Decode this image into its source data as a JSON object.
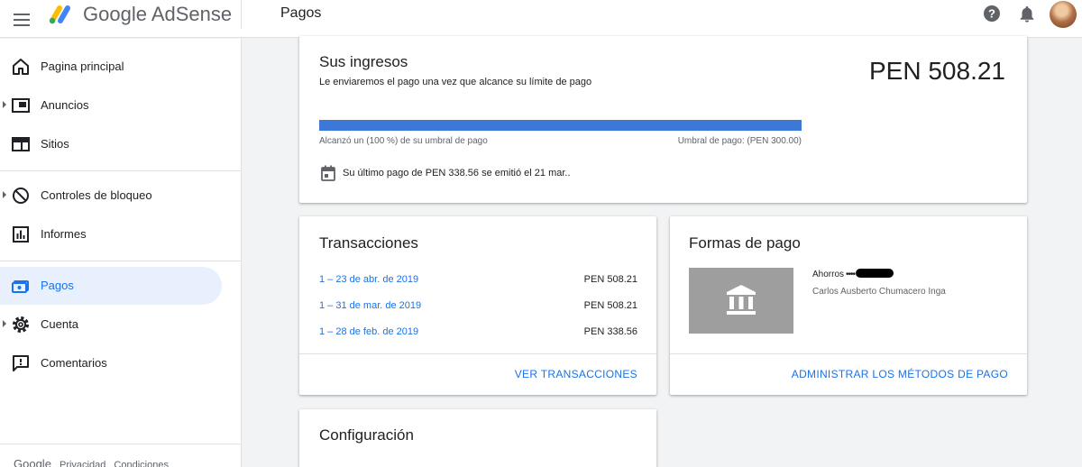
{
  "header": {
    "brand": "Google AdSense",
    "page_title": "Pagos"
  },
  "sidebar": {
    "items": [
      {
        "label": "Pagina principal",
        "icon": "home-icon"
      },
      {
        "label": "Anuncios",
        "icon": "ads-icon"
      },
      {
        "label": "Sitios",
        "icon": "sites-icon"
      },
      {
        "label": "Controles de bloqueo",
        "icon": "block-icon"
      },
      {
        "label": "Informes",
        "icon": "reports-icon"
      },
      {
        "label": "Pagos",
        "icon": "payments-icon",
        "active": true
      },
      {
        "label": "Cuenta",
        "icon": "gear-icon"
      },
      {
        "label": "Comentarios",
        "icon": "feedback-icon"
      }
    ],
    "footer": {
      "google": "Google",
      "privacy": "Privacidad",
      "terms": "Condiciones"
    }
  },
  "earnings": {
    "title": "Sus ingresos",
    "subtitle": "Le enviaremos el pago una vez que alcance su límite de pago",
    "amount": "PEN 508.21",
    "progress_fraction": 1.0,
    "progress_left": "Alcanzó un (100 %) de su umbral de pago",
    "progress_right": "Umbral de pago: (PEN 300.00)",
    "last_payment": "Su último pago de PEN 338.56 se emitió el 21 mar.."
  },
  "transactions": {
    "title": "Transacciones",
    "rows": [
      {
        "period": "1 – 23 de abr. de 2019",
        "amount": "PEN 508.21"
      },
      {
        "period": "1 – 31 de mar. de 2019",
        "amount": "PEN 508.21"
      },
      {
        "period": "1 – 28 de feb. de 2019",
        "amount": "PEN 338.56"
      }
    ],
    "action": "VER TRANSACCIONES"
  },
  "payment_methods": {
    "title": "Formas de pago",
    "account_type": "Ahorros",
    "account_mask": "••••",
    "account_holder": "Carlos Ausberto Chumacero Inga",
    "action": "ADMINISTRAR LOS MÉTODOS DE PAGO"
  },
  "settings": {
    "title": "Configuración"
  },
  "colors": {
    "accent": "#1a73e8",
    "progress": "#3c78d8",
    "active_nav_bg": "#e8f0fe",
    "bank_tile": "#9e9e9e"
  }
}
